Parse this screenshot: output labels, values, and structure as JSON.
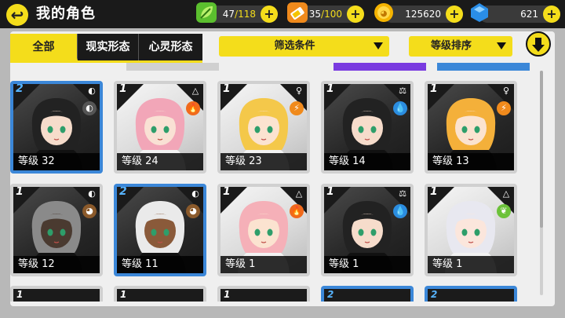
{
  "header": {
    "title": "我的角色",
    "stamina": {
      "current": "47",
      "max": "/118"
    },
    "energy": {
      "current": "35",
      "max": "/100"
    },
    "coins": "125620",
    "gems": "621"
  },
  "tabs": [
    "全部",
    "现实形态",
    "心灵形态"
  ],
  "filter": {
    "label": "筛选条件"
  },
  "sort": {
    "label": "等级排序"
  },
  "level_prefix": "等级",
  "cards": [
    {
      "stars": "2",
      "level": "等级 32",
      "element": "shield",
      "elem_color": "#555"
    },
    {
      "stars": "1",
      "level": "等级 24",
      "element": "fire",
      "elem_color": "#f06a1c"
    },
    {
      "stars": "1",
      "level": "等级 23",
      "element": "bolt",
      "elem_color": "#f08a1c"
    },
    {
      "stars": "1",
      "level": "等级 14",
      "element": "water",
      "elem_color": "#2b8de0"
    },
    {
      "stars": "1",
      "level": "等级 13",
      "element": "bolt",
      "elem_color": "#f08a1c"
    },
    {
      "stars": "1",
      "level": "等级 12",
      "element": "earth",
      "elem_color": "#8b5a2b"
    },
    {
      "stars": "2",
      "level": "等级 11",
      "element": "earth",
      "elem_color": "#8b5a2b"
    },
    {
      "stars": "1",
      "level": "等级 1",
      "element": "fire",
      "elem_color": "#f06a1c"
    },
    {
      "stars": "1",
      "level": "等级 1",
      "element": "water",
      "elem_color": "#2b8de0"
    },
    {
      "stars": "1",
      "level": "等级 1",
      "element": "leaf",
      "elem_color": "#6cc23a"
    }
  ],
  "peek_row_stars": [
    "1",
    "1",
    "1",
    "2",
    "2"
  ],
  "icons": {
    "back": "back-arrow-icon",
    "stamina": "leaf-icon",
    "energy": "battery-icon",
    "coins": "coin-icon",
    "gems": "gem-icon",
    "plus": "plus-icon",
    "sort_toggle": "down-arrow-icon"
  },
  "colors": {
    "accent": "#f4dd1b",
    "dark": "#1a1a1a",
    "blue_frame": "#3b87d8"
  }
}
